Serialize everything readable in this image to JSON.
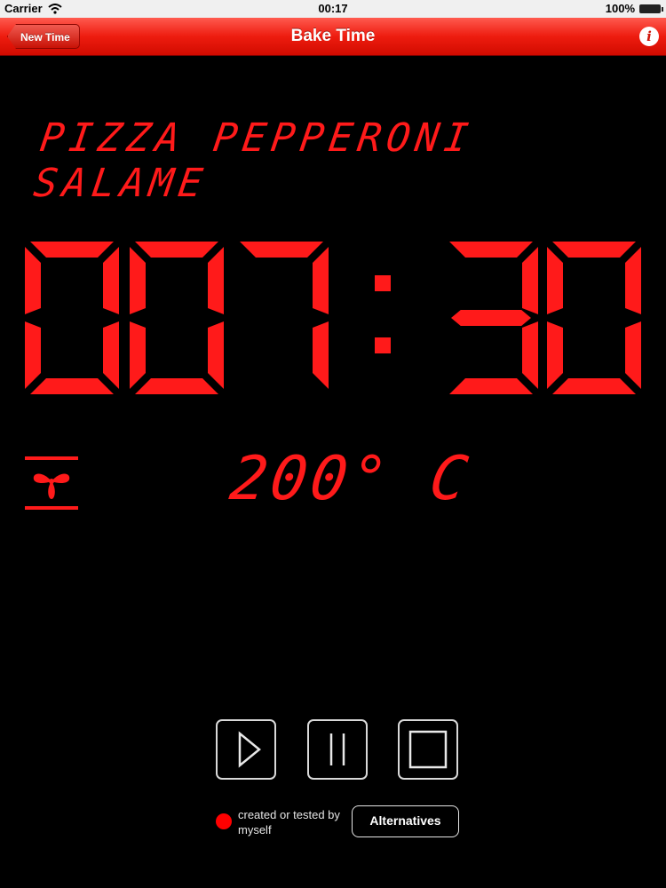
{
  "status_bar": {
    "carrier": "Carrier",
    "time": "00:17",
    "battery": "100%"
  },
  "nav": {
    "title": "Bake Time",
    "back_label": "New Time",
    "info_icon": "info-icon"
  },
  "recipe": {
    "name": "PIZZA PEPPERONI SALAME"
  },
  "timer": {
    "display": "007:30",
    "digits": [
      "0",
      "0",
      "7",
      "3",
      "0"
    ]
  },
  "oven": {
    "mode_icon": "fan-oven-icon",
    "temperature": "200° C"
  },
  "controls": {
    "play_icon": "play-icon",
    "pause_icon": "pause-icon",
    "stop_icon": "stop-icon"
  },
  "source": {
    "status_text": "created or tested by myself",
    "status_color": "#ff0000",
    "alternatives_label": "Alternatives"
  },
  "colors": {
    "lcd_red": "#ff1a1a",
    "navbar_red": "#ee1c0f"
  }
}
